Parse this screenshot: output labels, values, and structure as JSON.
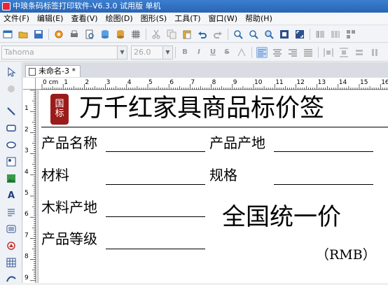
{
  "window": {
    "title": "中琅条码标签打印软件-V6.3.0 试用版 单机"
  },
  "menu": [
    "文件(F)",
    "编辑(E)",
    "查看(V)",
    "绘图(D)",
    "图形(S)",
    "工具(T)",
    "窗口(W)",
    "帮助(H)"
  ],
  "format_bar": {
    "font_placeholder": "Tahoma",
    "size_placeholder": "26.0",
    "bold": "B",
    "italic": "I",
    "underline": "U",
    "strike": "S"
  },
  "document": {
    "tab_title": "未命名-3 *"
  },
  "ruler": {
    "top_labels": [
      "0 cm",
      "1",
      "2",
      "3",
      "4",
      "5",
      "6",
      "7",
      "8",
      "9",
      "10",
      "11",
      "12",
      "13",
      "14",
      "15",
      "16"
    ],
    "left_labels": [
      "1",
      "2",
      "3",
      "4",
      "5",
      "6",
      "7",
      "8",
      "9"
    ]
  },
  "label": {
    "seal_text": [
      "国",
      "标"
    ],
    "title": "万千红家具商品标价签",
    "field_product_name": "产品名称",
    "field_origin": "产品产地",
    "field_material": "材料",
    "field_spec": "规格",
    "field_wood_origin": "木料产地",
    "field_grade": "产品等级",
    "price_text": "全国统一价",
    "currency": "（RMB）"
  },
  "icons": {
    "toolbar1": [
      "new-file-icon",
      "open-folder-icon",
      "save-icon",
      "settings-icon",
      "print-icon",
      "print-preview-icon",
      "database-icon",
      "database-settings-icon",
      "grid-icon",
      "cut-icon",
      "copy-icon",
      "paste-icon",
      "undo-icon",
      "redo-icon",
      "zoom-in-icon",
      "zoom-out-icon",
      "zoom-fit-icon",
      "zoom-actual-icon",
      "fullscreen-icon",
      "barcode-icon",
      "barcode-settings-icon",
      "qrcode-icon"
    ],
    "toolbar2": [
      "align-left-icon",
      "align-center-icon",
      "align-right-icon",
      "align-justify-icon",
      "distribute-h-icon",
      "distribute-v-icon",
      "same-width-icon",
      "same-height-icon"
    ],
    "left": [
      "pointer-icon",
      "hand-icon",
      "line-icon",
      "rectangle-icon",
      "ellipse-icon",
      "image-icon",
      "picture-icon",
      "text-icon",
      "rich-text-icon",
      "barcode-tool-icon",
      "shape-tool-icon",
      "table-tool-icon",
      "curve-tool-icon"
    ]
  }
}
